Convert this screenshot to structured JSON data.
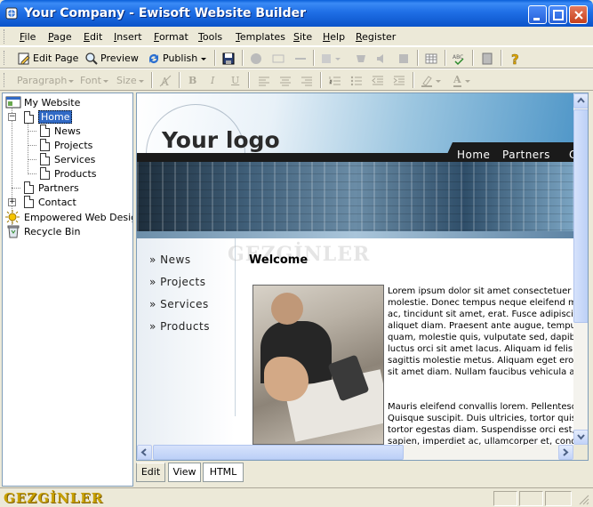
{
  "window": {
    "title": "Your Company - Ewisoft Website Builder"
  },
  "menu": [
    "File",
    "Page",
    "Edit",
    "Insert",
    "Format",
    "Tools",
    "Templates",
    "Site",
    "Help",
    "Register"
  ],
  "menu_underline": [
    "F",
    "P",
    "E",
    "I",
    "F",
    "T",
    "T",
    "S",
    "H",
    "R"
  ],
  "toolbar": {
    "edit_page": "Edit Page",
    "preview": "Preview",
    "publish": "Publish",
    "paragraph": "Paragraph",
    "font": "Font",
    "size": "Size",
    "bold": "B",
    "italic": "I",
    "underline": "U",
    "font_color": "A"
  },
  "tree": {
    "root": "My Website",
    "home": "Home",
    "home_children": [
      "News",
      "Projects",
      "Services",
      "Products"
    ],
    "partners": "Partners",
    "contact": "Contact",
    "empowered": "Empowered Web Design",
    "recycle": "Recycle Bin"
  },
  "preview": {
    "logo": "Your logo",
    "nav": [
      "Home",
      "Partners",
      "C"
    ],
    "left_nav": [
      "» News",
      "» Projects",
      "» Services",
      "» Products"
    ],
    "watermark": "GEZGİNLER",
    "heading": "Welcome",
    "paragraph1": [
      "Lorem ipsum dolor sit amet consectetuer adipiscing",
      "molestie. Donec tempus neque eleifend mauris",
      "ac, tincidunt sit amet, erat. Fusce adipiscing",
      "aliquet diam. Praesent ante augue, tempus a",
      "quam, molestie quis, vulputate sed, dapibus",
      "luctus orci sit amet lacus. Aliquam id felis non",
      "sagittis molestie metus. Aliquam eget eros. In",
      "sit amet diam. Nullam faucibus vehicula ante"
    ],
    "paragraph2": [
      "Mauris eleifend convallis lorem. Pellentesque",
      "Quisque suscipit. Duis ultricies, tortor quis a",
      "tortor egestas diam. Suspendisse orci est, v",
      "sapien, imperdiet ac, ullamcorper et, congue"
    ]
  },
  "view_tabs": [
    "Edit",
    "View",
    "HTML"
  ],
  "status": {
    "brand": "GEZGİNLER"
  },
  "colors": {
    "titlebar": "#0a53c9",
    "selection": "#316ac5",
    "banner_dark": "#1a1a1a"
  }
}
